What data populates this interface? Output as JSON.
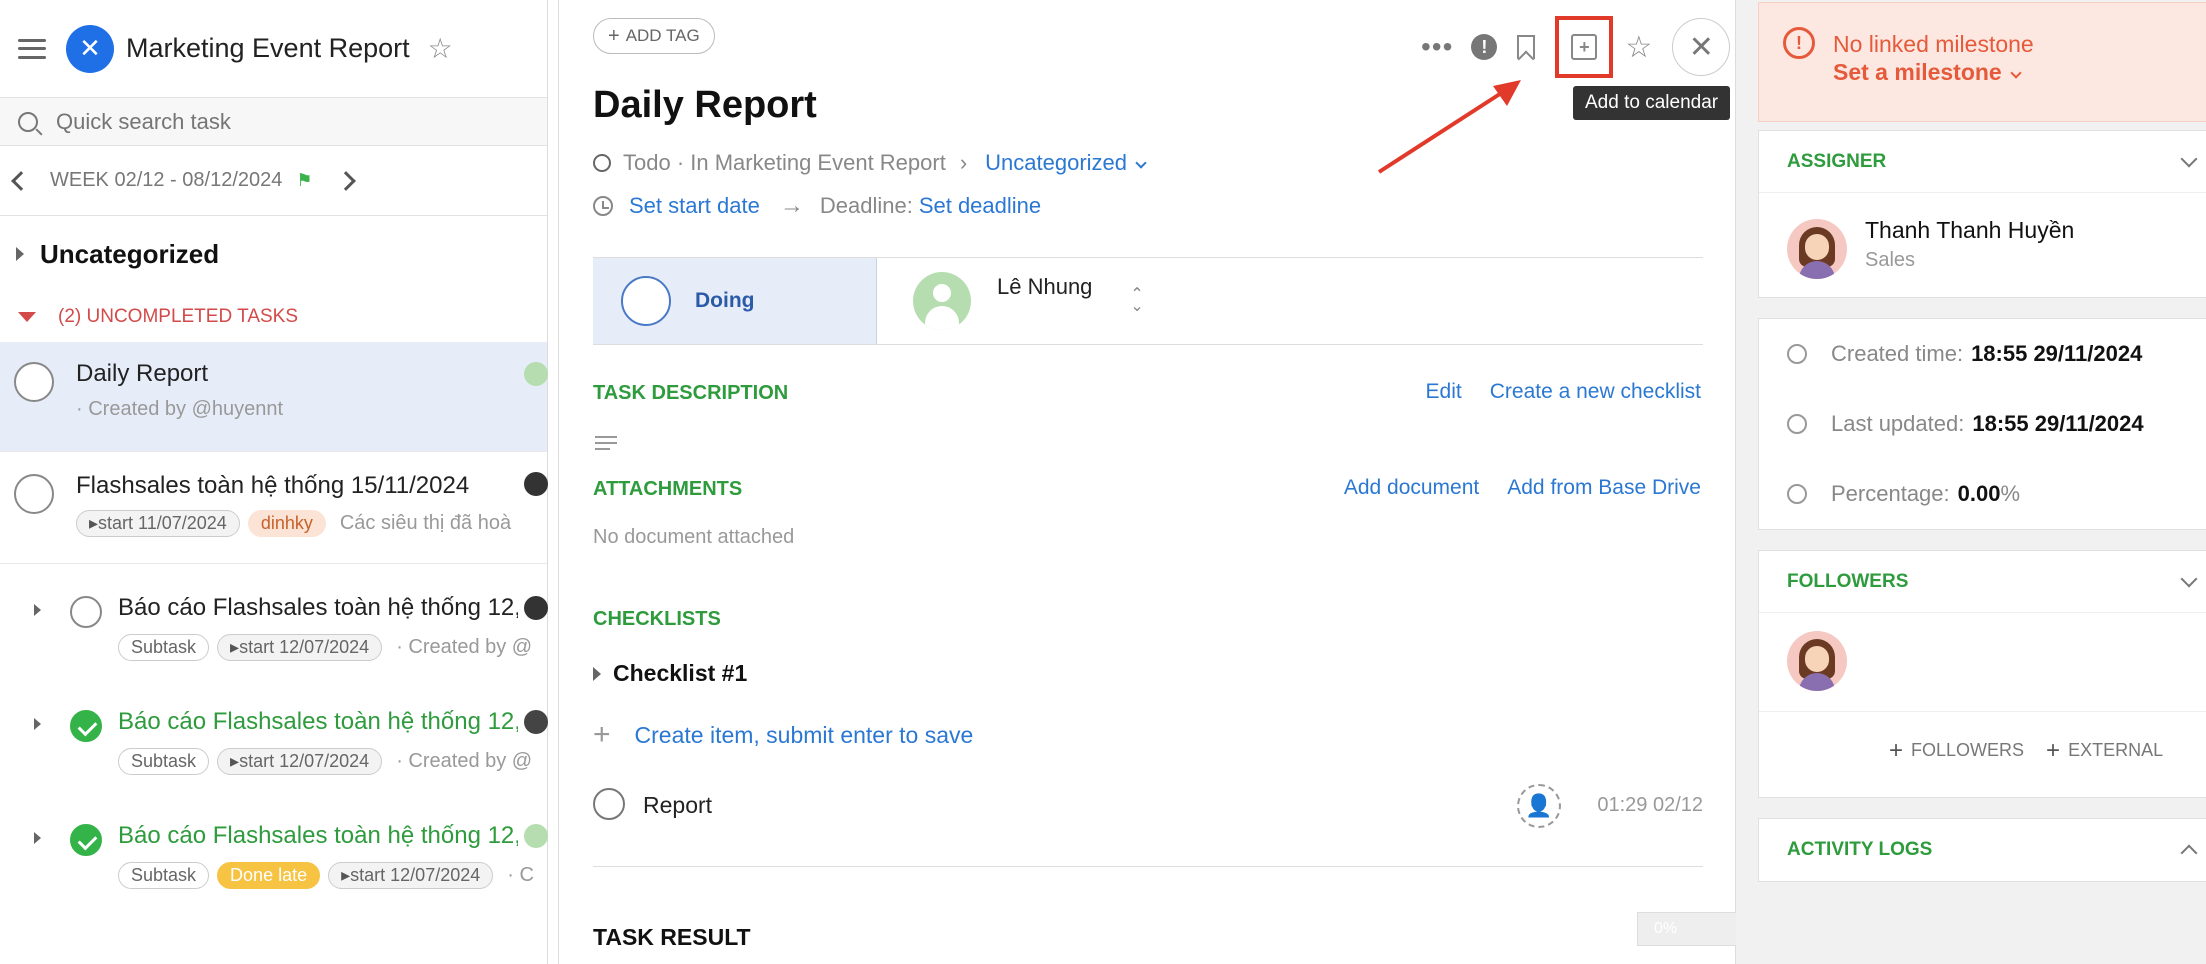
{
  "header": {
    "project_title": "Marketing Event Report"
  },
  "search": {
    "placeholder": "Quick search task"
  },
  "week": {
    "label": "WEEK 02/12 - 08/12/2024"
  },
  "group": {
    "title": "Uncategorized",
    "uncompleted_label": "(2) UNCOMPLETED TASKS"
  },
  "tasks": [
    {
      "title": "Daily Report",
      "sub": "· Created by @huyennt"
    },
    {
      "title": "Flashsales toàn hệ thống 15/11/2024",
      "start": "start 11/07/2024",
      "tag": "dinhky",
      "more": "Các siêu thị đã hoà"
    },
    {
      "title": "Báo cáo Flashsales toàn hệ thống 12,",
      "chip1": "Subtask",
      "start": "start 12/07/2024",
      "more": "· Created by @"
    },
    {
      "title": "Báo cáo Flashsales toàn hệ thống 12,",
      "chip1": "Subtask",
      "start": "start 12/07/2024",
      "more": "· Created by @"
    },
    {
      "title": "Báo cáo Flashsales toàn hệ thống 12,",
      "chip1": "Subtask",
      "chip2": "Done late",
      "start": "start 12/07/2024",
      "more": "· C"
    }
  ],
  "detail": {
    "add_tag": "ADD TAG",
    "tooltip": "Add to calendar",
    "title": "Daily Report",
    "status_text": "Todo · In Marketing Event Report",
    "category": "Uncategorized",
    "set_start": "Set start date",
    "deadline_label": "Deadline:",
    "set_deadline": "Set deadline",
    "doing": "Doing",
    "assignee": "Lê Nhung",
    "task_description": "TASK DESCRIPTION",
    "edit": "Edit",
    "create_checklist": "Create a new checklist",
    "attachments": "ATTACHMENTS",
    "add_document": "Add document",
    "add_from_drive": "Add from Base Drive",
    "no_document": "No document attached",
    "checklists": "CHECKLISTS",
    "checklist_name": "Checklist #1",
    "create_item": "Create item, submit enter to save",
    "item_name": "Report",
    "item_time": "01:29 02/12",
    "task_result": "TASK RESULT",
    "progress": "0%"
  },
  "sidebar": {
    "milestone_none": "No linked milestone",
    "milestone_set": "Set a milestone",
    "assigner_label": "ASSIGNER",
    "assigner_name": "Thanh Thanh Huyền",
    "assigner_dept": "Sales",
    "created_label": "Created time:",
    "created_value": "18:55 29/11/2024",
    "updated_label": "Last updated:",
    "updated_value": "18:55 29/11/2024",
    "percentage_label": "Percentage:",
    "percentage_value": "0.00",
    "percentage_unit": "%",
    "followers_label": "FOLLOWERS",
    "followers_btn": "FOLLOWERS",
    "external_btn": "EXTERNAL",
    "activity_label": "ACTIVITY LOGS"
  },
  "colors": {
    "accent_blue": "#2b78d3",
    "section_green": "#2e9b3d",
    "highlight_red": "#e13a2a",
    "milestone_orange": "#e55a3a"
  }
}
